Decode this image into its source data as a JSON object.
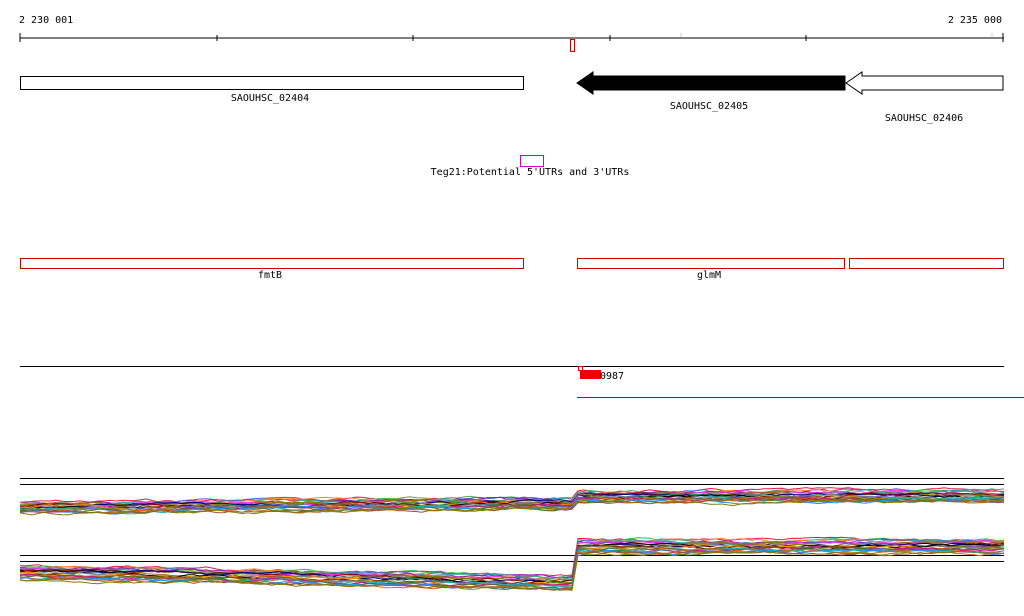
{
  "coordinates": {
    "start_label": "2 230 001",
    "end_label": "2 235 000"
  },
  "genes": [
    {
      "label": "SAOUHSC_02404"
    },
    {
      "label": "SAOUHSC_02405"
    },
    {
      "label": "SAOUHSC_02406"
    }
  ],
  "annotation": {
    "label": "Teg21:Potential 5'UTRs and 3'UTRs"
  },
  "features": [
    {
      "label": "fmtB"
    },
    {
      "label": "glmM"
    },
    {
      "label": ""
    }
  ],
  "marker": {
    "label": "0987"
  },
  "colors": {
    "feature_outline": "#cc0000",
    "annotation_outline": "#cc00cc",
    "marker_fill": "#ee0000",
    "gene_fill_selected": "#000000",
    "axis": "#000000"
  },
  "track_colors": [
    "#e6194b",
    "#3cb44b",
    "#4363d8",
    "#f58231",
    "#911eb4",
    "#46a0a0",
    "#f032e6",
    "#9a6324",
    "#808000",
    "#800000",
    "#000075",
    "#808080",
    "#000000",
    "#ff8c00",
    "#2e8b57",
    "#8b4513",
    "#6a5acd",
    "#b8860b",
    "#c71585",
    "#20b2aa",
    "#556b2f",
    "#d2691e",
    "#1e90ff",
    "#a0522d",
    "#7f7f00"
  ]
}
